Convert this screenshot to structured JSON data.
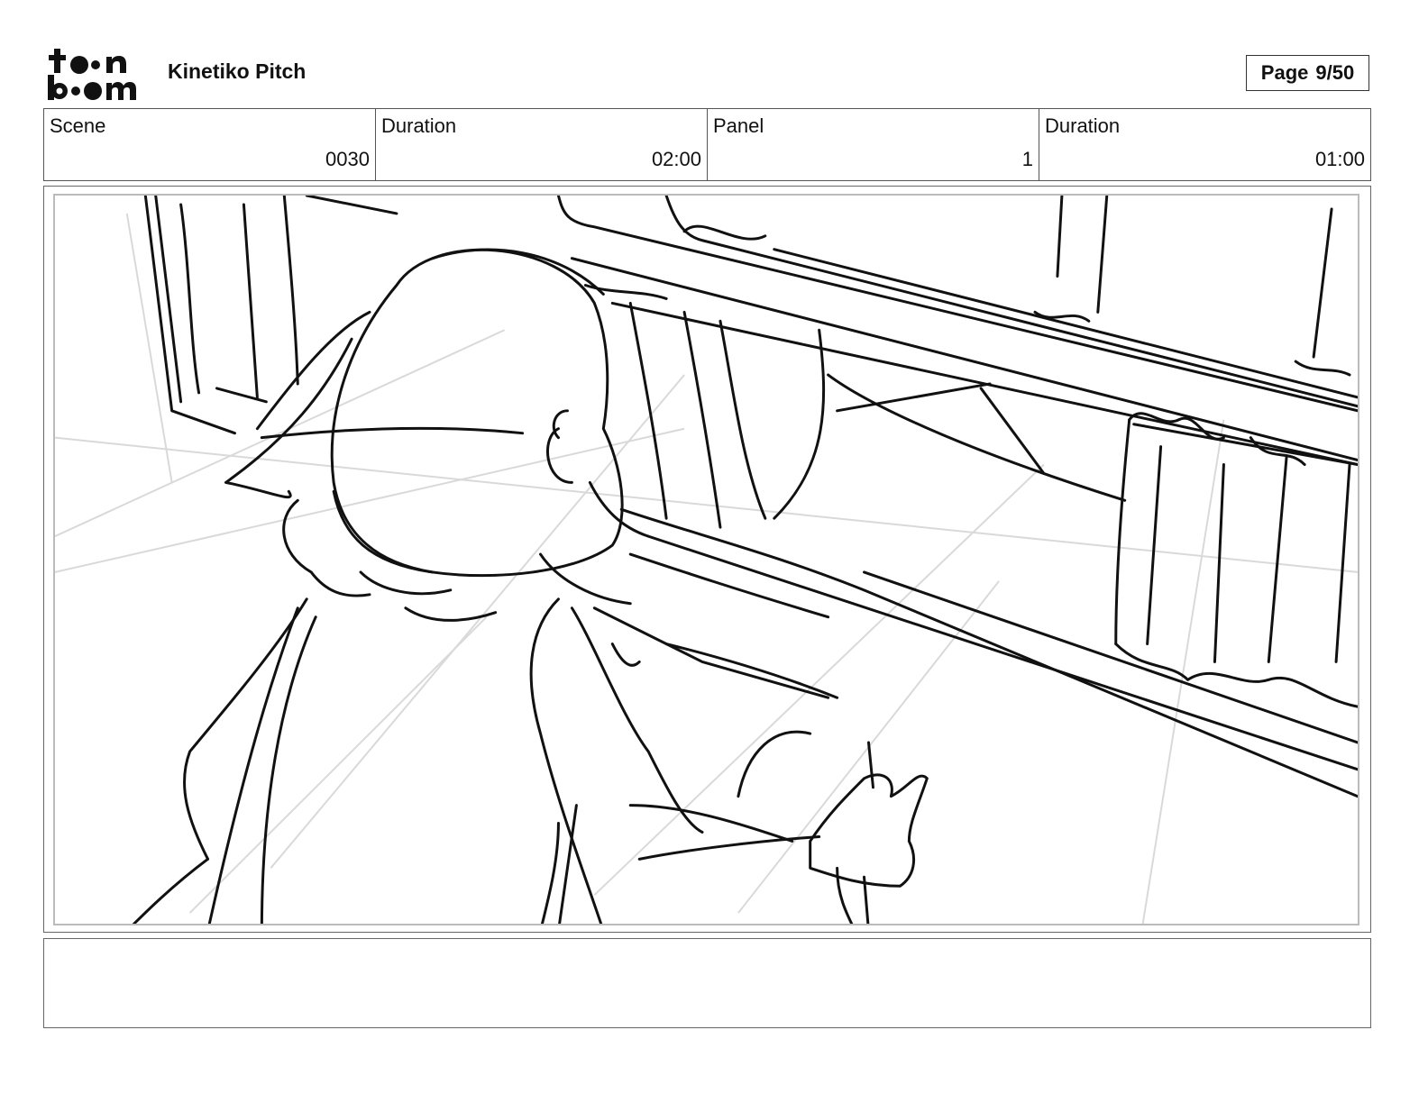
{
  "header": {
    "logo": {
      "line1": "toon",
      "line2": "boom"
    },
    "project_title": "Kinetiko Pitch",
    "page_label": "Page",
    "page_number": "9/50"
  },
  "info": {
    "scene_label": "Scene",
    "scene_value": "0030",
    "scene_duration_label": "Duration",
    "scene_duration_value": "02:00",
    "panel_label": "Panel",
    "panel_value": "1",
    "panel_duration_label": "Duration",
    "panel_duration_value": "01:00"
  },
  "panel": {
    "description": "Rough storyboard sketch: girl seen from behind leaning over a store shelf by a curtained window"
  },
  "caption": {
    "text": ""
  }
}
